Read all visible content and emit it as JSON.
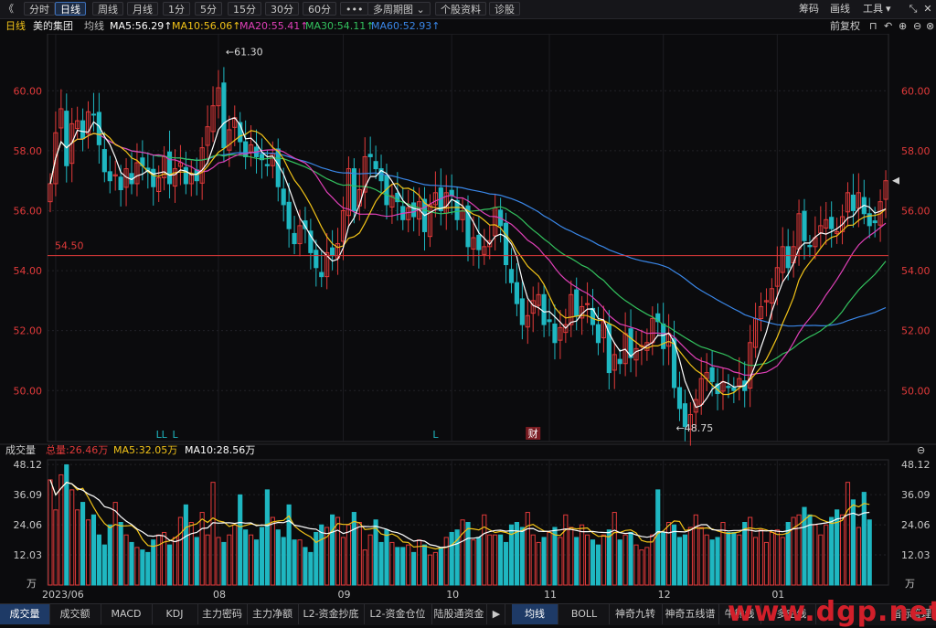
{
  "toolbar": {
    "nav_back": "《",
    "buttons": [
      "分时",
      "日线",
      "周线",
      "月线",
      "1分",
      "5分",
      "15分",
      "30分",
      "60分",
      "•••",
      "多周期图 ⌄",
      "个股资料",
      "诊股"
    ],
    "active_index": 1,
    "right_links": [
      "筹码",
      "画线",
      "工具"
    ],
    "tools_dropdown": "▾"
  },
  "legend": {
    "period": "日线",
    "stock": "美的集团",
    "avg": "均线",
    "ma5": "MA5:56.29↑",
    "ma10": "MA10:56.06↑",
    "ma20": "MA20:55.41↑",
    "ma30": "MA30:54.11↑",
    "ma60": "MA60:52.93↑",
    "adjust": "前复权"
  },
  "colors": {
    "up": "#e23a3a",
    "down": "#1fb7c1",
    "ma5": "#ffffff",
    "ma10": "#f2c318",
    "ma20": "#e040b8",
    "ma30": "#33c25e",
    "ma60": "#3a87e8",
    "axis_text": "#e23a3a",
    "ref_line": "#e23a3a",
    "accent": "#1e3a66"
  },
  "chart_data": {
    "type": "candlestick",
    "y_ticks": [
      "60.00",
      "58.00",
      "56.00",
      "54.00",
      "52.00",
      "50.00"
    ],
    "ylim": [
      48.3,
      61.9
    ],
    "x_labels": [
      {
        "label": "2023/06",
        "index": 1
      },
      {
        "label": "08",
        "index": 31
      },
      {
        "label": "09",
        "index": 54
      },
      {
        "label": "10",
        "index": 74
      },
      {
        "label": "11",
        "index": 92
      },
      {
        "label": "12",
        "index": 113
      },
      {
        "label": "01",
        "index": 134
      }
    ],
    "ref_line": {
      "value": 54.5,
      "label": "54.50"
    },
    "annotations": [
      {
        "text": "←61.30",
        "index": 32,
        "value": 61.3
      },
      {
        "text": "←48.75",
        "index": 115,
        "value": 48.75
      }
    ],
    "markers": [
      {
        "text": "L",
        "index": 20
      },
      {
        "text": "L",
        "index": 21
      },
      {
        "text": "L",
        "index": 23
      },
      {
        "text": "L",
        "index": 71
      },
      {
        "text": "财",
        "index": 89
      }
    ],
    "closes": [
      56.9,
      58.6,
      59.4,
      57.5,
      58.9,
      59.0,
      58.4,
      59.3,
      59.2,
      58.2,
      57.3,
      57.0,
      57.2,
      56.7,
      57.4,
      56.9,
      57.6,
      57.5,
      57.3,
      56.8,
      57.1,
      57.8,
      56.9,
      57.4,
      57.6,
      56.9,
      57.2,
      57.0,
      58.1,
      58.8,
      59.5,
      60.1,
      58.1,
      58.7,
      59.1,
      58.3,
      57.8,
      58.2,
      57.8,
      57.7,
      57.5,
      57.9,
      56.8,
      56.2,
      55.4,
      54.9,
      55.5,
      55.4,
      54.6,
      54.1,
      53.8,
      54.6,
      54.5,
      54.9,
      56.0,
      57.4,
      56.0,
      56.7,
      57.8,
      57.8,
      57.4,
      57.0,
      56.2,
      56.5,
      56.3,
      55.7,
      56.1,
      55.8,
      56.3,
      55.3,
      56.2,
      56.6,
      56.0,
      56.6,
      56.5,
      55.7,
      56.0,
      54.8,
      55.1,
      54.7,
      54.8,
      55.0,
      56.1,
      55.5,
      54.2,
      53.6,
      52.9,
      52.2,
      52.5,
      53.0,
      53.2,
      52.2,
      52.3,
      51.6,
      52.1,
      52.2,
      53.2,
      52.5,
      52.8,
      52.9,
      52.2,
      51.6,
      52.3,
      50.6,
      51.2,
      50.9,
      51.9,
      51.1,
      51.4,
      51.5,
      51.6,
      52.4,
      52.3,
      51.4,
      51.9,
      50.1,
      49.4,
      48.8,
      49.2,
      49.7,
      50.4,
      50.6,
      50.3,
      49.9,
      50.3,
      50.1,
      50.0,
      50.4,
      50.0,
      51.6,
      52.4,
      52.8,
      53.0,
      53.4,
      54.1,
      54.8,
      54.1,
      54.8,
      55.9,
      55.0,
      54.8,
      55.1,
      55.5,
      55.7,
      55.4,
      55.3,
      55.8,
      56.6,
      56.0,
      56.6,
      55.9,
      55.5,
      55.6,
      56.3,
      57.0
    ],
    "volume": {
      "y_ticks": [
        "48.12",
        "36.09",
        "24.06",
        "12.03"
      ],
      "unit": "万",
      "ylim": [
        0,
        50
      ],
      "total": "总量:26.46万",
      "ma5": "MA5:32.05万",
      "ma10": "MA10:28.56万",
      "values": [
        42,
        30,
        44,
        48,
        38,
        30,
        33,
        26,
        28,
        20,
        16,
        24,
        33,
        25,
        20,
        17,
        15,
        14,
        13,
        18,
        20,
        21,
        16,
        19,
        27,
        32,
        25,
        19,
        29,
        20,
        41,
        19,
        17,
        20,
        24,
        36,
        22,
        20,
        18,
        23,
        38,
        27,
        22,
        19,
        32,
        18,
        18,
        15,
        13,
        21,
        24,
        23,
        28,
        27,
        19,
        24,
        29,
        25,
        14,
        20,
        26,
        17,
        22,
        17,
        15,
        15,
        16,
        13,
        18,
        16,
        12,
        13,
        15,
        19,
        21,
        22,
        26,
        25,
        18,
        19,
        28,
        20,
        20,
        20,
        17,
        24,
        25,
        23,
        29,
        20,
        17,
        19,
        21,
        23,
        19,
        28,
        23,
        19,
        24,
        20,
        18,
        16,
        20,
        22,
        29,
        18,
        20,
        21,
        16,
        14,
        15,
        20,
        38,
        21,
        25,
        24,
        19,
        20,
        23,
        28,
        23,
        20,
        18,
        19,
        25,
        21,
        21,
        20,
        25,
        27,
        19,
        22,
        17,
        21,
        22,
        19,
        25,
        27,
        28,
        31,
        28,
        24,
        20,
        24,
        27,
        30,
        28,
        41,
        34,
        23,
        37,
        26
      ]
    }
  },
  "volhdr": {
    "title": "成交量"
  },
  "bottombar": {
    "tabs_left": [
      "成交量",
      "成交额",
      "MACD",
      "KDJ",
      "主力密码",
      "主力净额",
      "L2-资金抄底",
      "L2-资金仓位",
      "陆股通资金"
    ],
    "more": "▶",
    "tabs_right": [
      "均线",
      "BOLL",
      "神奇九转",
      "神奇五线谱",
      "牛熊线",
      "多空线",
      "指标管理"
    ],
    "watermark": "www.dgp.net"
  }
}
